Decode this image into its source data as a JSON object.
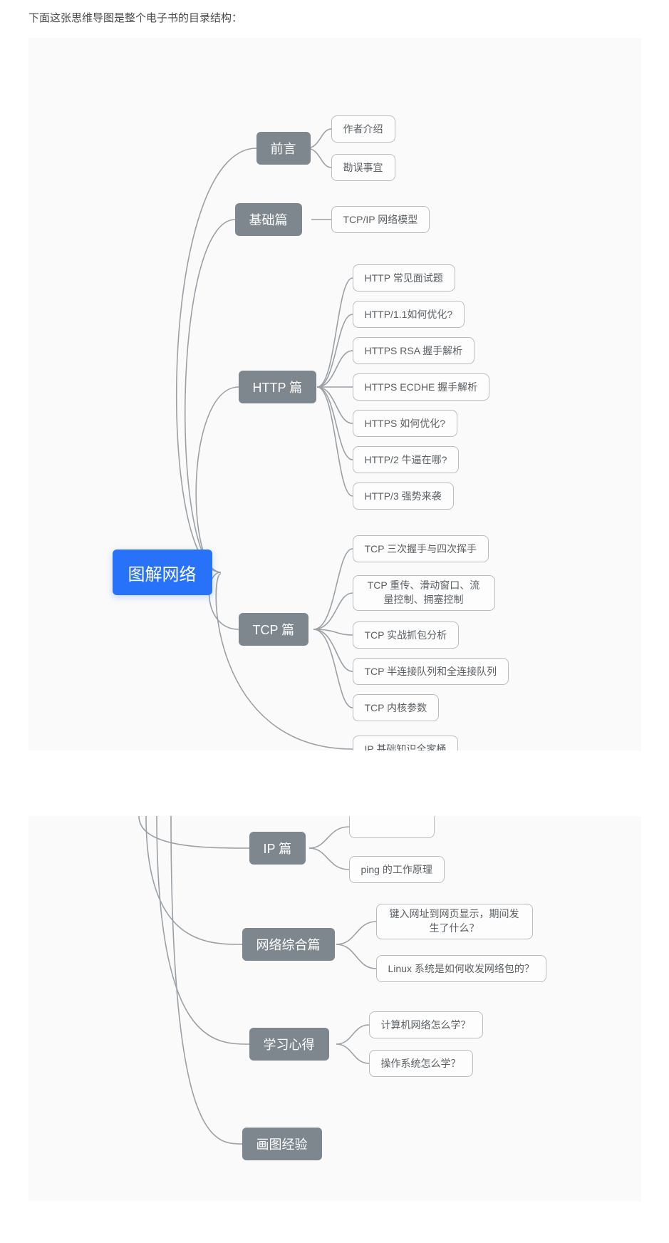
{
  "intro": "下面这张思维导图是整个电子书的目录结构：",
  "root": "图解网络",
  "sections": {
    "preface": {
      "title": "前言",
      "items": [
        "作者介绍",
        "勘误事宜"
      ]
    },
    "basic": {
      "title": "基础篇",
      "items": [
        "TCP/IP 网络模型"
      ]
    },
    "http": {
      "title": "HTTP 篇",
      "items": [
        "HTTP 常见面试题",
        "HTTP/1.1如何优化?",
        "HTTPS RSA 握手解析",
        "HTTPS ECDHE 握手解析",
        "HTTPS 如何优化?",
        "HTTP/2 牛逼在哪?",
        "HTTP/3 强势来袭"
      ]
    },
    "tcp": {
      "title": "TCP 篇",
      "items": [
        "TCP 三次握手与四次挥手",
        "TCP 重传、滑动窗口、流量控制、拥塞控制",
        "TCP 实战抓包分析",
        "TCP 半连接队列和全连接队列",
        "TCP 内核参数"
      ]
    },
    "ip": {
      "title": "IP 篇",
      "items": [
        "IP 基础知识全家桶",
        "ping 的工作原理"
      ]
    },
    "integ": {
      "title": "网络综合篇",
      "items": [
        "键入网址到网页显示，期间发生了什么？",
        "Linux 系统是如何收发网络包的？"
      ]
    },
    "study": {
      "title": "学习心得",
      "items": [
        "计算机网络怎么学？",
        "操作系统怎么学？"
      ]
    },
    "draw": {
      "title": "画图经验",
      "items": []
    }
  }
}
